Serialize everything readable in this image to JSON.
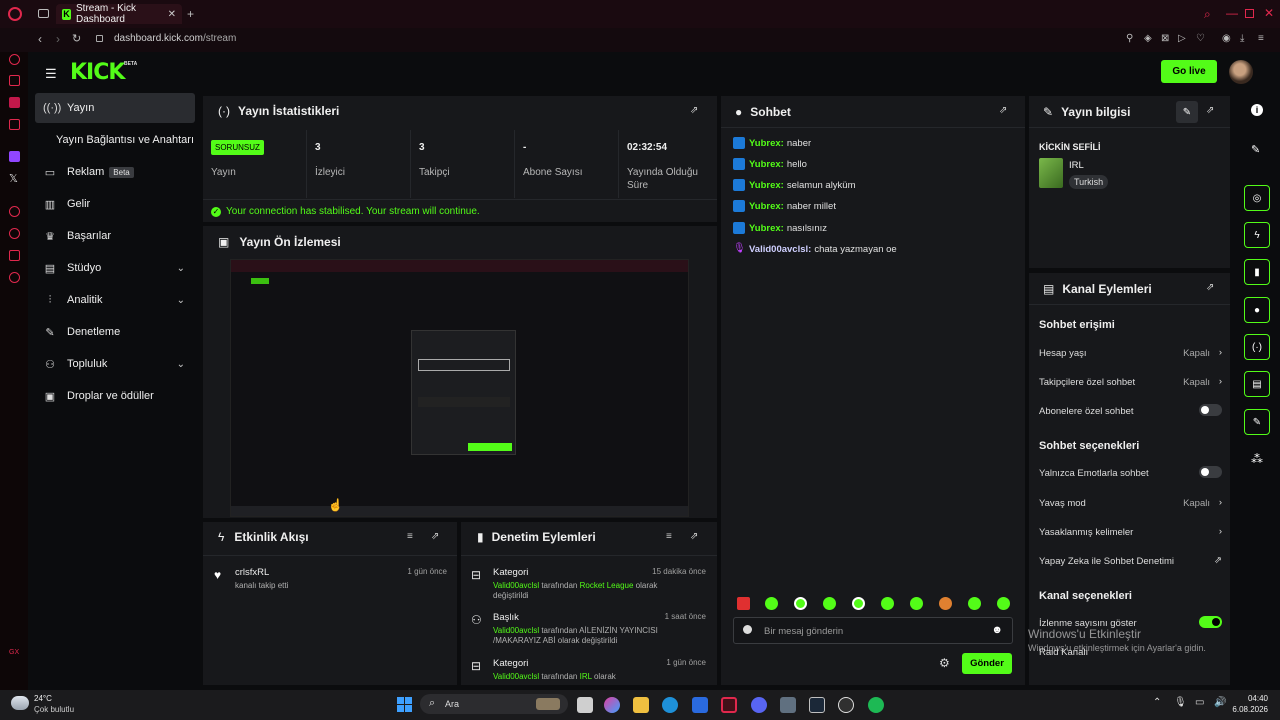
{
  "browser": {
    "tab_title": "Stream - Kick Dashboard",
    "url_host": "dashboard.kick.com",
    "url_path": "/stream"
  },
  "header": {
    "logo": "KICK",
    "logo_sup": "BETA",
    "go_live": "Go live"
  },
  "sidebar": {
    "items": [
      {
        "label": "Yayın",
        "icon": "broadcast-icon"
      },
      {
        "label": "Yayın Bağlantısı ve Anahtarı",
        "icon": ""
      },
      {
        "label": "Reklam",
        "icon": "ad-icon",
        "badge": "Beta"
      },
      {
        "label": "Gelir",
        "icon": "chart-icon"
      },
      {
        "label": "Başarılar",
        "icon": "trophy-icon"
      },
      {
        "label": "Stüdyo",
        "icon": "studio-icon"
      },
      {
        "label": "Analitik",
        "icon": "analytics-icon"
      },
      {
        "label": "Denetleme",
        "icon": "wrench-icon"
      },
      {
        "label": "Topluluk",
        "icon": "community-icon"
      },
      {
        "label": "Droplar ve ödüller",
        "icon": "gift-icon"
      }
    ]
  },
  "stats": {
    "title": "Yayın İstatistikleri",
    "status": "SORUNSUZ",
    "status_label": "Yayın",
    "viewers_value": "3",
    "viewers_label": "İzleyici",
    "followers_value": "3",
    "followers_label": "Takipçi",
    "subs_value": "-",
    "subs_label": "Abone Sayısı",
    "time_value": "02:32:54",
    "time_label": "Yayında Olduğu Süre",
    "message": "Your connection has stabilised. Your stream will continue."
  },
  "preview": {
    "title": "Yayın Ön İzlemesi"
  },
  "activity": {
    "title": "Etkinlik Akışı",
    "items": [
      {
        "user": "crlsfxRL",
        "text": "kanalı takip etti",
        "time": "1 gün önce"
      }
    ]
  },
  "moderation": {
    "title": "Denetim Eylemleri",
    "items": [
      {
        "type": "Kategori",
        "time": "15 dakika önce",
        "user": "Valid00avclsl",
        "text1": " tarafından ",
        "value": "Rocket League",
        "text2": " olarak",
        "text3": "değiştirildi"
      },
      {
        "type": "Başlık",
        "time": "1 saat önce",
        "user": "Valid00avclsl",
        "text1": " tarafından AİLENİZİN YAYINCISI",
        "value": "",
        "text2": "",
        "text3": "/MAKARAYIZ ABİ olarak değiştirildi"
      },
      {
        "type": "Kategori",
        "time": "1 gün önce",
        "user": "Valid00avclsl",
        "text1": " tarafından ",
        "value": "IRL",
        "text2": " olarak",
        "text3": ""
      }
    ]
  },
  "chat": {
    "title": "Sohbet",
    "messages": [
      {
        "user": "Yubrex:",
        "text": "naber"
      },
      {
        "user": "Yubrex:",
        "text": "hello"
      },
      {
        "user": "Yubrex:",
        "text": "selamun alyküm"
      },
      {
        "user": "Yubrex:",
        "text": "naber millet"
      },
      {
        "user": "Yubrex:",
        "text": "nasılsınız"
      },
      {
        "user": "Valid00avclsl:",
        "text": "chata yazmayan oe"
      }
    ],
    "placeholder": "Bir mesaj gönderin",
    "send": "Gönder"
  },
  "stream_info": {
    "title": "Yayın bilgisi",
    "stream_title": "KİCKİN SEFİLİ",
    "category": "IRL",
    "language": "Turkish"
  },
  "channel_actions": {
    "title": "Kanal Eylemleri",
    "chat_access_head": "Sohbet erişimi",
    "account_age": "Hesap yaşı",
    "account_age_val": "Kapalı",
    "followers_only": "Takipçilere özel sohbet",
    "followers_only_val": "Kapalı",
    "subs_only": "Abonelere özel sohbet",
    "chat_options_head": "Sohbet seçenekleri",
    "emotes_only": "Yalnızca Emotlarla sohbet",
    "slow_mode": "Yavaş mod",
    "slow_mode_val": "Kapalı",
    "banned_words": "Yasaklanmış kelimeler",
    "ai_mod": "Yapay Zeka ile Sohbet Denetimi",
    "channel_options_head": "Kanal seçenekleri",
    "show_viewers": "İzlenme sayısını göster",
    "raid": "Raid Kanalı",
    "viewers_toggle": 1,
    "subs_toggle": 0,
    "emotes_toggle": 0
  },
  "watermark": {
    "line1": "Windows'u Etkinleştir",
    "line2": "Windows'u etkinleştirmek için Ayarlar'a gidin."
  },
  "taskbar": {
    "weather_temp": "24°C",
    "weather_desc": "Çok bulutlu",
    "search": "Ara",
    "time": "04:40",
    "date": "6.08.2026"
  },
  "colors": {
    "accent": "#53fc18",
    "panel": "#17181b",
    "bg": "#0b0c0e"
  }
}
